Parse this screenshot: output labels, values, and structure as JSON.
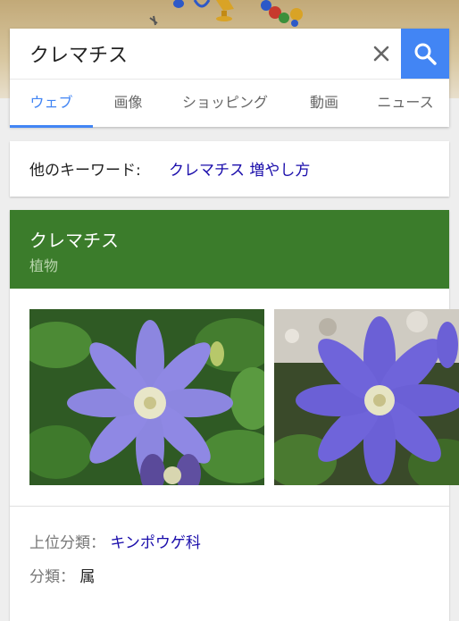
{
  "search": {
    "query": "クレマチス",
    "clear_icon": "close-icon",
    "submit_icon": "search-icon"
  },
  "tabs": [
    {
      "label": "ウェブ",
      "active": true
    },
    {
      "label": "画像",
      "active": false
    },
    {
      "label": "ショッピング",
      "active": false
    },
    {
      "label": "動画",
      "active": false
    },
    {
      "label": "ニュース",
      "active": false
    }
  ],
  "related": {
    "label": "他のキーワード:",
    "link": "クレマチス 増やし方"
  },
  "knowledge_panel": {
    "title": "クレマチス",
    "subtitle": "植物",
    "header_color": "#3b7c2b",
    "images": [
      {
        "subject": "purple clematis flower"
      },
      {
        "subject": "purple clematis flower"
      }
    ],
    "facts": [
      {
        "key": "上位分類：",
        "value": "キンポウゲ科",
        "is_link": true
      },
      {
        "key": "分類：",
        "value": "属",
        "is_link": false
      }
    ]
  },
  "colors": {
    "accent": "#4285f4",
    "link": "#1a0dab"
  }
}
